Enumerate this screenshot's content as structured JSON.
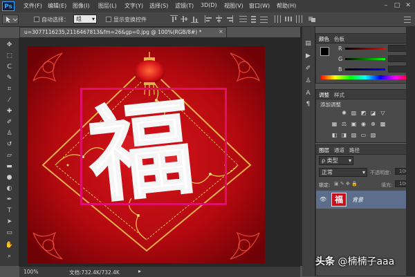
{
  "app": {
    "logo": "Ps"
  },
  "menu": [
    "文件(F)",
    "编辑(E)",
    "图像(I)",
    "图层(L)",
    "文字(Y)",
    "选择(S)",
    "滤镜(T)",
    "3D(D)",
    "视图(V)",
    "窗口(W)",
    "帮助(H)"
  ],
  "window_controls": {
    "minimize": "–",
    "maximize": "□",
    "close": "✕"
  },
  "options": {
    "auto_select_label": "自动选择：",
    "auto_select_value": "组",
    "show_transform_label": "显示变换控件"
  },
  "document": {
    "tab_title": "u=3077116235,2116467813&fm=26&gp=0.jpg @ 100%(RGB/8#) *",
    "close": "×",
    "artwork_glyph": "福",
    "zoom": "100%",
    "doc_size": "文档:732.4K/732.4K"
  },
  "color_panel": {
    "tabs": [
      "颜色",
      "色板"
    ],
    "channels": [
      {
        "label": "R",
        "value": "4"
      },
      {
        "label": "G",
        "value": "0"
      },
      {
        "label": "B",
        "value": "0"
      }
    ]
  },
  "adjust_panel": {
    "tabs": [
      "调整",
      "样式"
    ],
    "subtitle": "添加调整"
  },
  "layers_panel": {
    "tabs": [
      "图层",
      "通道",
      "路径"
    ],
    "filter_label": "ρ 类型",
    "blend_mode": "正常",
    "opacity_label": "不透明度:",
    "opacity_value": "100%",
    "lock_label": "锁定:",
    "fill_label": "填充:",
    "fill_value": "100%",
    "layer_name": "背景",
    "layer_thumb_glyph": "福"
  },
  "watermark": {
    "brand": "头条",
    "handle": "@楠楠子aaa"
  },
  "colors": {
    "accent": "#e0106a",
    "foreground_swatch": "#000000",
    "background_swatch": "#ffffff",
    "artwork_red": "#c8101c"
  }
}
